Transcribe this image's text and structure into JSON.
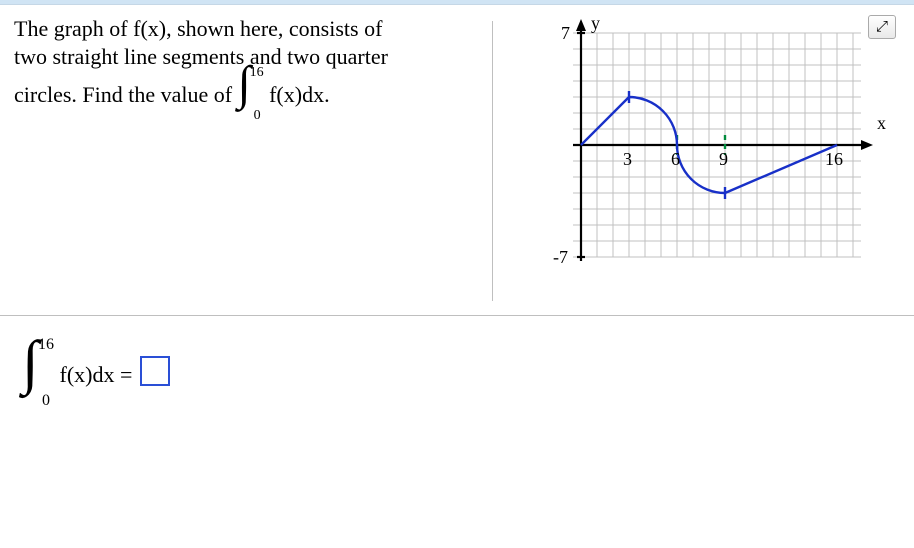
{
  "problem": {
    "line1": "The graph of f(x), shown here, consists of",
    "line2": "two straight line segments and two quarter",
    "line3a": "circles. Find the value of",
    "integrand": " f(x)dx.",
    "upper": "16",
    "lower": "0"
  },
  "answer": {
    "upper": "16",
    "lower": "0",
    "integrand": "f(x)dx",
    "equals": " = "
  },
  "graph": {
    "y_top": "7",
    "y_bottom": "-7",
    "x_ticks": [
      "3",
      "6",
      "9",
      "16"
    ],
    "ylabel": "y",
    "xlabel": "x"
  },
  "icons": {
    "expand": "⤢"
  },
  "chart_data": {
    "type": "line",
    "title": "",
    "xlabel": "x",
    "ylabel": "y",
    "xlim": [
      0,
      16
    ],
    "ylim": [
      -7,
      7
    ],
    "x_ticks": [
      3,
      6,
      9,
      16
    ],
    "y_ticks": [
      -7,
      7
    ],
    "description": "f(x): line segment from (0,0) to (3,3); quarter circle center (3,0) radius 3 from (3,3) to (6,0); quarter circle center (9,0) radius 3 from (6,0) to (9,-3); line segment from (9,-3) to (16,0)",
    "pieces": [
      {
        "kind": "segment",
        "from": [
          0,
          0
        ],
        "to": [
          3,
          3
        ]
      },
      {
        "kind": "quarter_circle",
        "center": [
          3,
          0
        ],
        "radius": 3,
        "from": [
          3,
          3
        ],
        "to": [
          6,
          0
        ]
      },
      {
        "kind": "quarter_circle",
        "center": [
          9,
          0
        ],
        "radius": 3,
        "from": [
          6,
          0
        ],
        "to": [
          9,
          -3
        ]
      },
      {
        "kind": "segment",
        "from": [
          9,
          -3
        ],
        "to": [
          16,
          0
        ]
      }
    ],
    "green_dashed_x": [
      6,
      9
    ]
  }
}
